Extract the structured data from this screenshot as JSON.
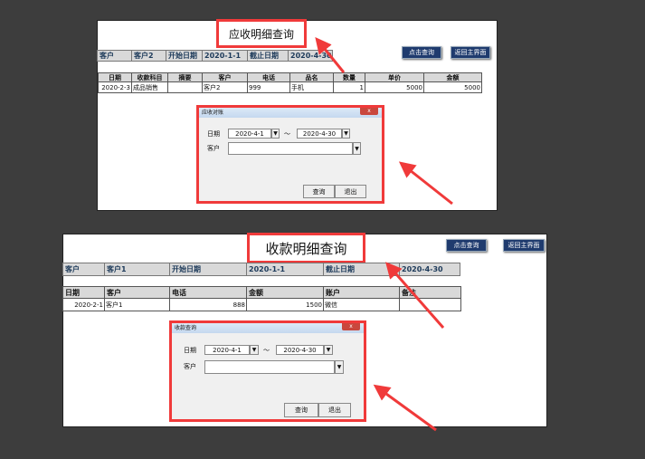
{
  "receivable": {
    "title": "应收明细查询",
    "filter": {
      "customer_label": "客户",
      "customer_value": "客户2",
      "start_label": "开始日期",
      "start_value": "2020-1-1",
      "end_label": "截止日期",
      "end_value": "2020-4-30"
    },
    "buttons": {
      "query": "点击查询",
      "back": "返回主界面"
    },
    "columns": [
      "日期",
      "收款科目",
      "摘要",
      "客户",
      "电话",
      "品名",
      "数量",
      "单价",
      "金额"
    ],
    "rows": [
      [
        "2020-2-3",
        "成品销售",
        "",
        "客户2",
        "999",
        "手机",
        "1",
        "5000",
        "5000"
      ]
    ],
    "dialog": {
      "title": "应收对账",
      "date_label": "日期",
      "from": "2020-4-1",
      "sep": "～",
      "to": "2020-4-30",
      "customer_label": "客户",
      "customer_value": "",
      "query": "查询",
      "exit": "退出",
      "close": "x"
    }
  },
  "payment": {
    "title": "收款明细查询",
    "filter": {
      "customer_label": "客户",
      "customer_value": "客户1",
      "start_label": "开始日期",
      "start_value": "2020-1-1",
      "end_label": "截止日期",
      "end_value": "2020-4-30"
    },
    "buttons": {
      "query": "点击查询",
      "back": "返回主界面"
    },
    "columns": [
      "日期",
      "客户",
      "电话",
      "金额",
      "账户",
      "备注"
    ],
    "rows": [
      [
        "2020-2-1",
        "客户1",
        "888",
        "1500",
        "微信",
        ""
      ]
    ],
    "dialog": {
      "title": "收款查询",
      "date_label": "日期",
      "from": "2020-4-1",
      "sep": "～",
      "to": "2020-4-30",
      "customer_label": "客户",
      "customer_value": "",
      "query": "查询",
      "exit": "退出",
      "close": "x"
    }
  },
  "colors": {
    "annotation": "#f03a3a",
    "button": "#1f3b6e"
  }
}
